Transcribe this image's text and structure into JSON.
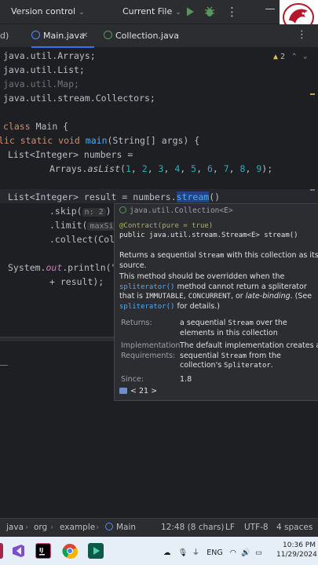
{
  "toolbar": {
    "version_control": "Version control",
    "run_config": "Current File"
  },
  "tabs": [
    {
      "label": "d)"
    },
    {
      "label": "Main.java",
      "active": true
    },
    {
      "label": "Collection.java"
    }
  ],
  "editor": {
    "warnings": "2",
    "lines": {
      "l1": "java.util.Arrays;",
      "l2": "java.util.List;",
      "l3": "java.util.Map;",
      "l4": "java.util.stream.Collectors;",
      "l5_kw": "class",
      "l5_name": "Main {",
      "l6_kw": "lic static void",
      "l6_fn": "main",
      "l6_rest": "(String[] args) {",
      "l7": "List<Integer> numbers =",
      "l8_a": "Arrays.",
      "l8_fn": "asList",
      "l8_nums": [
        "1",
        "2",
        "3",
        "4",
        "5",
        "6",
        "7",
        "8",
        "9"
      ],
      "l8_end": ");",
      "l9_a": "List<Integer> result = numbers.",
      "l9_sel": "stream",
      "l9_end": "()",
      "l10": ".skip(",
      "l10_hint": "n: 2",
      "l10_end": ")",
      "l11": ".limit(",
      "l11_hint": "maxSize",
      "l12": ".collect(Coll",
      "l13_a": "System.",
      "l13_fld": "out",
      "l13_b": ".println(\"",
      "l14": "+ result);"
    }
  },
  "popup": {
    "header": "java.util.Collection<E>",
    "annotation": "@Contract(pure = true)",
    "signature": "public java.util.stream.Stream<E> stream()",
    "desc1_a": "Returns a sequential",
    "desc1_code": "Stream",
    "desc1_b": "with this collection as its source.",
    "desc2_a": "This method should be overridden when the",
    "desc2_link": "spliterator()",
    "desc2_b": "method cannot return a spliterator that is",
    "desc2_c1": "IMMUTABLE",
    "desc2_c2": "CONCURRENT",
    "desc2_or": "or",
    "desc2_it": "late-binding",
    "desc2_see": ". (See",
    "desc2_link2": "spliterator()",
    "desc2_end": "for details.)",
    "returns_label": "Returns:",
    "returns_a": "a sequential",
    "returns_code": "Stream",
    "returns_b": "over the elements in this collection",
    "impl_label_1": "Implementation",
    "impl_label_2": "Requirements:",
    "impl_a": "The default implementation creates a sequential",
    "impl_code": "Stream",
    "impl_b": "from the collection's",
    "impl_code2": "Spliterator",
    "since_label": "Since:",
    "since_value": "1.8",
    "footer": "< 21 >"
  },
  "statusbar": {
    "crumbs": [
      "java",
      "org",
      "example",
      "Main"
    ],
    "position": "12:48 (8 chars)",
    "line_sep": "LF",
    "encoding": "UTF-8",
    "indent": "4 spaces"
  },
  "taskbar": {
    "language": "ENG",
    "time": "10:36 PM",
    "date": "11/29/2024"
  },
  "colors": {
    "accent": "#3574f0",
    "keyword": "#cf8e6d",
    "function": "#56a8f5",
    "number": "#2aacb8"
  }
}
